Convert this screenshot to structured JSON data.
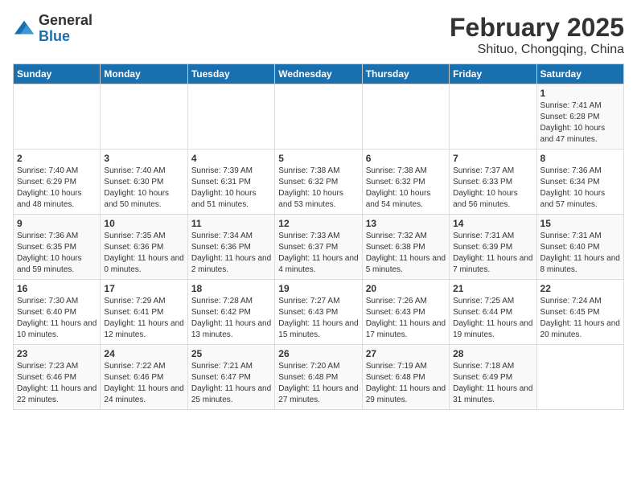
{
  "logo": {
    "general": "General",
    "blue": "Blue"
  },
  "title": "February 2025",
  "subtitle": "Shituo, Chongqing, China",
  "days_header": [
    "Sunday",
    "Monday",
    "Tuesday",
    "Wednesday",
    "Thursday",
    "Friday",
    "Saturday"
  ],
  "weeks": [
    [
      {
        "day": "",
        "info": ""
      },
      {
        "day": "",
        "info": ""
      },
      {
        "day": "",
        "info": ""
      },
      {
        "day": "",
        "info": ""
      },
      {
        "day": "",
        "info": ""
      },
      {
        "day": "",
        "info": ""
      },
      {
        "day": "1",
        "info": "Sunrise: 7:41 AM\nSunset: 6:28 PM\nDaylight: 10 hours and 47 minutes."
      }
    ],
    [
      {
        "day": "2",
        "info": "Sunrise: 7:40 AM\nSunset: 6:29 PM\nDaylight: 10 hours and 48 minutes."
      },
      {
        "day": "3",
        "info": "Sunrise: 7:40 AM\nSunset: 6:30 PM\nDaylight: 10 hours and 50 minutes."
      },
      {
        "day": "4",
        "info": "Sunrise: 7:39 AM\nSunset: 6:31 PM\nDaylight: 10 hours and 51 minutes."
      },
      {
        "day": "5",
        "info": "Sunrise: 7:38 AM\nSunset: 6:32 PM\nDaylight: 10 hours and 53 minutes."
      },
      {
        "day": "6",
        "info": "Sunrise: 7:38 AM\nSunset: 6:32 PM\nDaylight: 10 hours and 54 minutes."
      },
      {
        "day": "7",
        "info": "Sunrise: 7:37 AM\nSunset: 6:33 PM\nDaylight: 10 hours and 56 minutes."
      },
      {
        "day": "8",
        "info": "Sunrise: 7:36 AM\nSunset: 6:34 PM\nDaylight: 10 hours and 57 minutes."
      }
    ],
    [
      {
        "day": "9",
        "info": "Sunrise: 7:36 AM\nSunset: 6:35 PM\nDaylight: 10 hours and 59 minutes."
      },
      {
        "day": "10",
        "info": "Sunrise: 7:35 AM\nSunset: 6:36 PM\nDaylight: 11 hours and 0 minutes."
      },
      {
        "day": "11",
        "info": "Sunrise: 7:34 AM\nSunset: 6:36 PM\nDaylight: 11 hours and 2 minutes."
      },
      {
        "day": "12",
        "info": "Sunrise: 7:33 AM\nSunset: 6:37 PM\nDaylight: 11 hours and 4 minutes."
      },
      {
        "day": "13",
        "info": "Sunrise: 7:32 AM\nSunset: 6:38 PM\nDaylight: 11 hours and 5 minutes."
      },
      {
        "day": "14",
        "info": "Sunrise: 7:31 AM\nSunset: 6:39 PM\nDaylight: 11 hours and 7 minutes."
      },
      {
        "day": "15",
        "info": "Sunrise: 7:31 AM\nSunset: 6:40 PM\nDaylight: 11 hours and 8 minutes."
      }
    ],
    [
      {
        "day": "16",
        "info": "Sunrise: 7:30 AM\nSunset: 6:40 PM\nDaylight: 11 hours and 10 minutes."
      },
      {
        "day": "17",
        "info": "Sunrise: 7:29 AM\nSunset: 6:41 PM\nDaylight: 11 hours and 12 minutes."
      },
      {
        "day": "18",
        "info": "Sunrise: 7:28 AM\nSunset: 6:42 PM\nDaylight: 11 hours and 13 minutes."
      },
      {
        "day": "19",
        "info": "Sunrise: 7:27 AM\nSunset: 6:43 PM\nDaylight: 11 hours and 15 minutes."
      },
      {
        "day": "20",
        "info": "Sunrise: 7:26 AM\nSunset: 6:43 PM\nDaylight: 11 hours and 17 minutes."
      },
      {
        "day": "21",
        "info": "Sunrise: 7:25 AM\nSunset: 6:44 PM\nDaylight: 11 hours and 19 minutes."
      },
      {
        "day": "22",
        "info": "Sunrise: 7:24 AM\nSunset: 6:45 PM\nDaylight: 11 hours and 20 minutes."
      }
    ],
    [
      {
        "day": "23",
        "info": "Sunrise: 7:23 AM\nSunset: 6:46 PM\nDaylight: 11 hours and 22 minutes."
      },
      {
        "day": "24",
        "info": "Sunrise: 7:22 AM\nSunset: 6:46 PM\nDaylight: 11 hours and 24 minutes."
      },
      {
        "day": "25",
        "info": "Sunrise: 7:21 AM\nSunset: 6:47 PM\nDaylight: 11 hours and 25 minutes."
      },
      {
        "day": "26",
        "info": "Sunrise: 7:20 AM\nSunset: 6:48 PM\nDaylight: 11 hours and 27 minutes."
      },
      {
        "day": "27",
        "info": "Sunrise: 7:19 AM\nSunset: 6:48 PM\nDaylight: 11 hours and 29 minutes."
      },
      {
        "day": "28",
        "info": "Sunrise: 7:18 AM\nSunset: 6:49 PM\nDaylight: 11 hours and 31 minutes."
      },
      {
        "day": "",
        "info": ""
      }
    ]
  ]
}
